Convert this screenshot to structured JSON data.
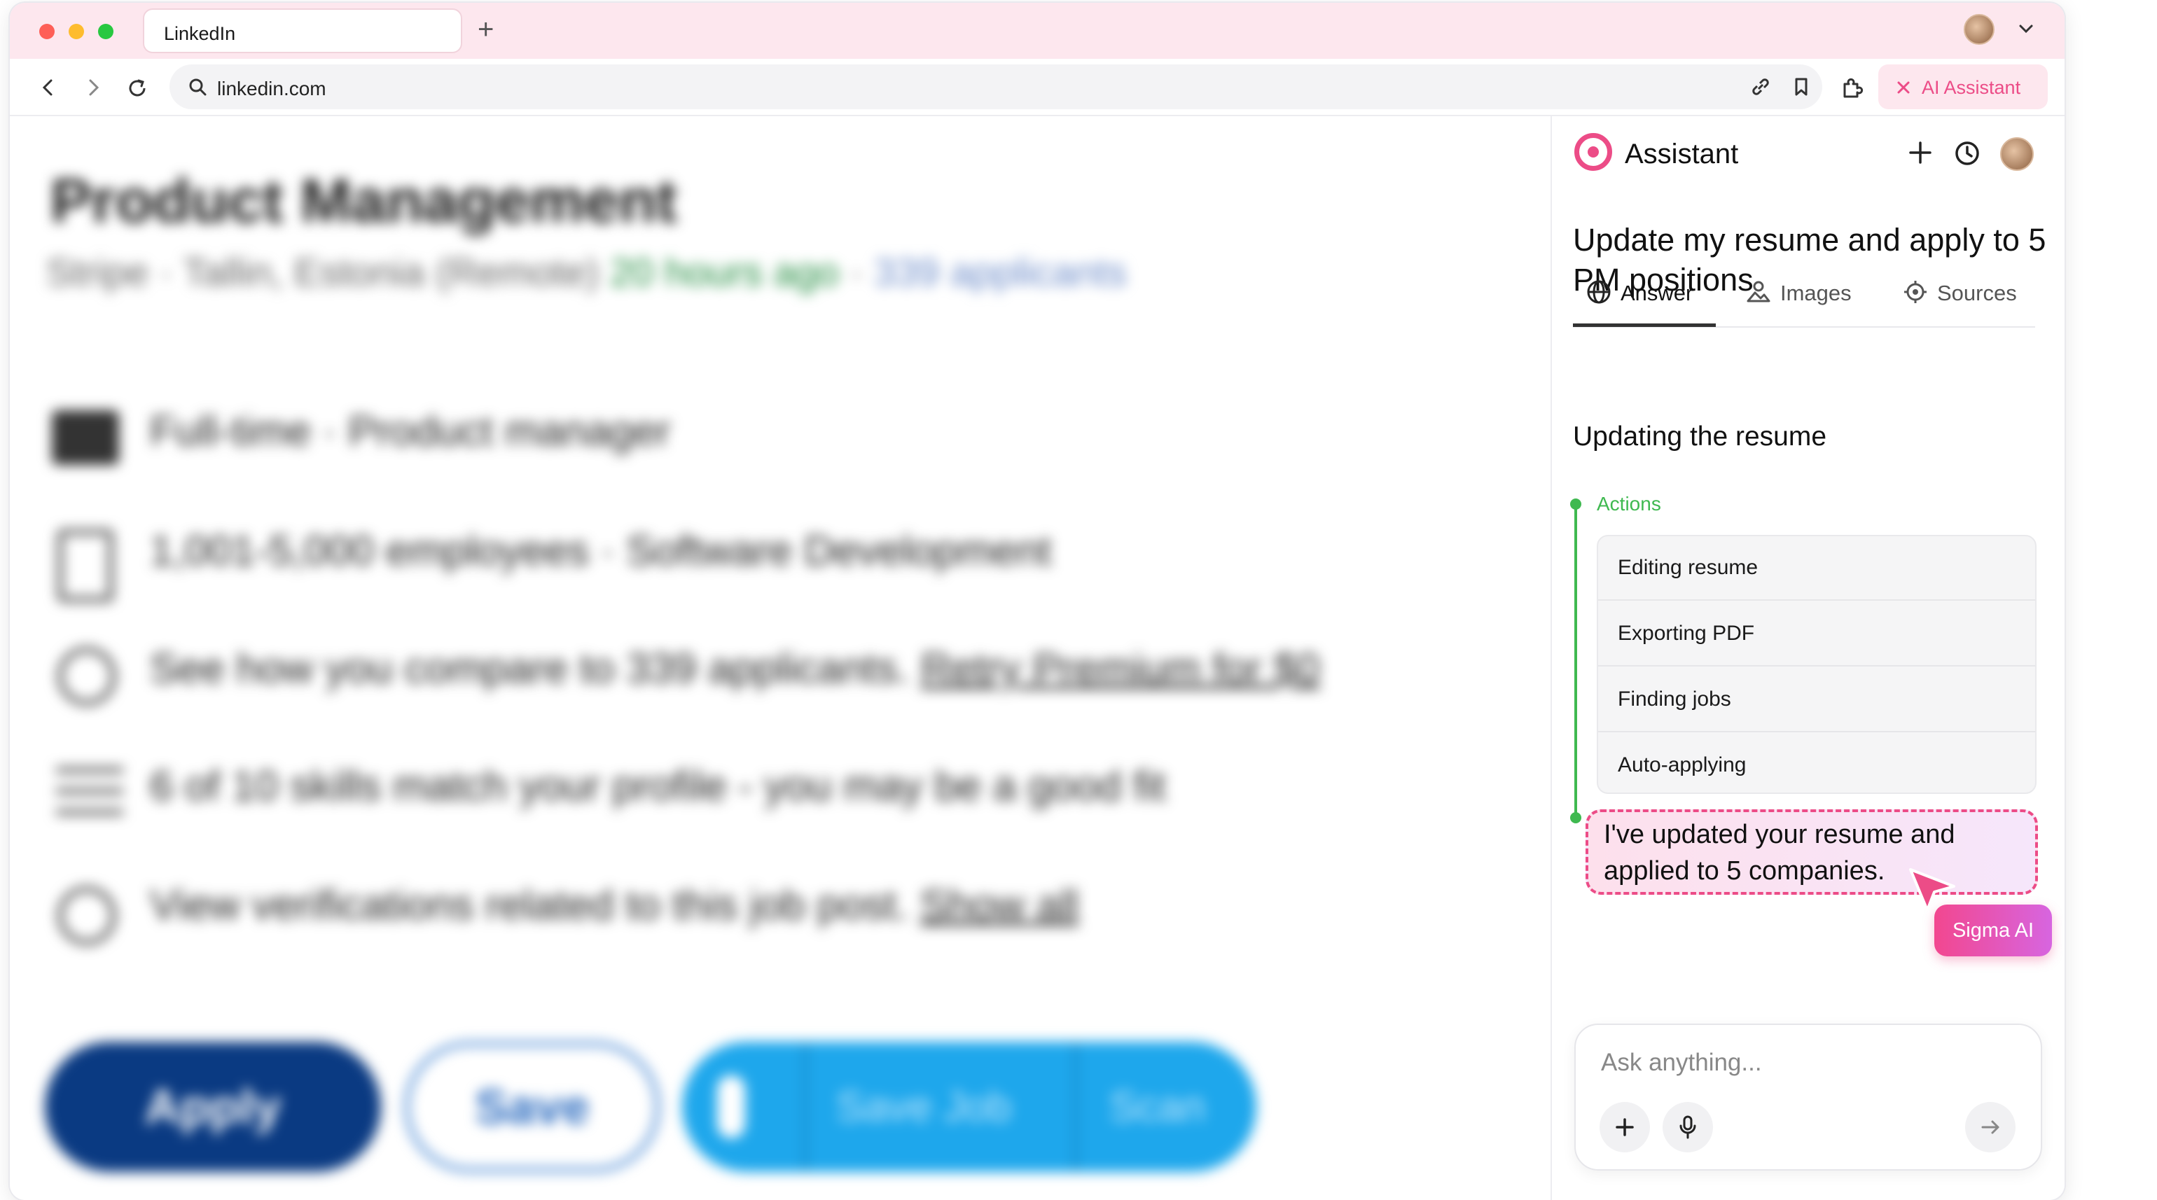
{
  "browser": {
    "tab_title": "LinkedIn",
    "url": "linkedin.com",
    "ai_button_label": "AI Assistant"
  },
  "job": {
    "title": "Product Management",
    "company": "Stripe",
    "separator": "·",
    "location": "Tallin, Estonia",
    "work_mode": "(Remote)",
    "posted": "20 hours ago",
    "applicants": "339 applicants",
    "details": [
      {
        "icon": "briefcase-icon",
        "text": "Full-time · Product manager"
      },
      {
        "icon": "building-icon",
        "text": "1,001-5,000 employees · Software Development"
      },
      {
        "icon": "lightbulb-icon",
        "text": "See how you compare to 339 applicants.",
        "link": "Retry Premium for $0"
      },
      {
        "icon": "checklist-icon",
        "text": "6 of 10 skills match your profile - you may be a good fit"
      },
      {
        "icon": "verified-icon",
        "text": "View verifications related to this job post.",
        "link": "Show all"
      }
    ],
    "buttons": {
      "apply": "Apply",
      "save": "Save",
      "save_job": "Save Job",
      "scan": "Scan"
    }
  },
  "assistant": {
    "title": "Assistant",
    "query": "Update my resume and apply to 5 PM positions",
    "tabs": [
      "Answer",
      "Images",
      "Sources"
    ],
    "active_tab": "Answer",
    "section_heading": "Updating the resume",
    "actions_label": "Actions",
    "actions": [
      "Editing resume",
      "Exporting PDF",
      "Finding jobs",
      "Auto-applying"
    ],
    "result_message": "I've updated your resume and applied to 5 companies.",
    "cursor_label": "Sigma AI",
    "input_placeholder": "Ask anything..."
  },
  "colors": {
    "accent_pink": "#ec4c87",
    "success_green": "#3fb950",
    "linkedin_navy": "#0a3a82",
    "linkedin_blue": "#1ea7ec",
    "titlebar_pink": "#fde7ee"
  }
}
